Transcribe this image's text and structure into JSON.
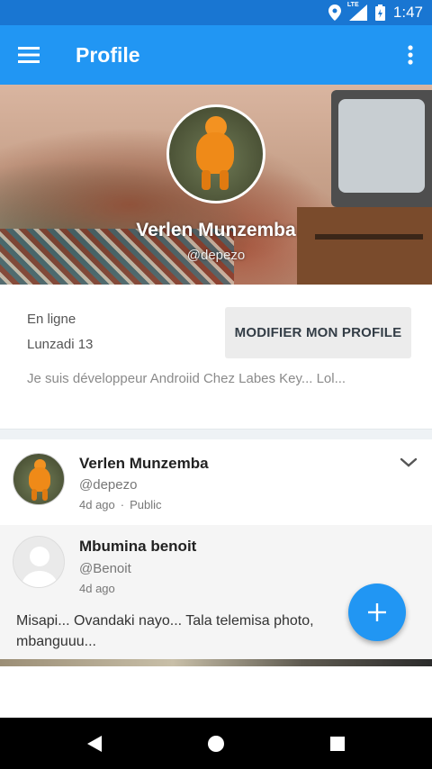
{
  "status_bar": {
    "time": "1:47",
    "network_label": "LTE",
    "icons": [
      "location-icon",
      "signal-icon",
      "battery-charging-icon"
    ]
  },
  "app_bar": {
    "title": "Profile",
    "menu_icon": "hamburger-menu-icon",
    "more_icon": "more-vert-icon"
  },
  "profile": {
    "name": "Verlen Munzemba",
    "handle": "@depezo",
    "status": "En ligne",
    "date": "Lunzadi 13",
    "edit_button": "MODIFIER MON PROFILE",
    "bio": "Je suis développeur Androiid Chez Labes Key... Lol..."
  },
  "post": {
    "author": "Verlen Munzemba",
    "handle": "@depezo",
    "time": "4d ago",
    "separator": "·",
    "visibility": "Public"
  },
  "shared_post": {
    "author": "Mbumina benoit",
    "handle": "@Benoit",
    "time": "4d ago",
    "text": "Misapi... Ovandaki nayo... Tala telemisa photo, mbanguuu..."
  },
  "colors": {
    "primary": "#2196f3",
    "status_bar": "#1976d2",
    "accent_button": "#ececec"
  }
}
